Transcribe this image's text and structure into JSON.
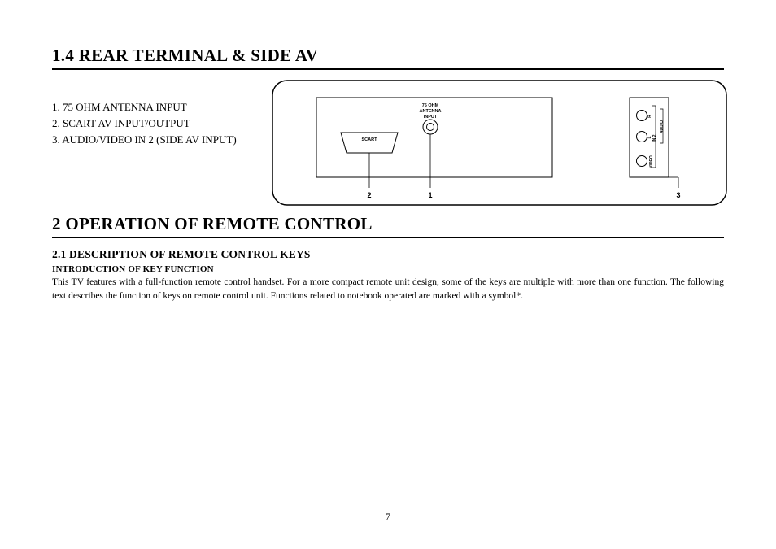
{
  "section1": {
    "heading": "1.4 REAR TERMINAL & SIDE AV",
    "items": [
      "1.  75 OHM ANTENNA INPUT",
      "2.  SCART AV INPUT/OUTPUT",
      "3.  AUDIO/VIDEO IN 2 (SIDE AV INPUT)"
    ]
  },
  "section2": {
    "heading": "2 OPERATION OF REMOTE CONTROL",
    "sub_heading": "2.1 DESCRIPTION OF REMOTE CONTROL KEYS",
    "intro_heading": "INTRODUCTION OF KEY FUNCTION",
    "body": "This TV features with a full-function remote control handset. For a more compact remote unit design, some of the keys are multiple with more than one function. The following text describes the function of keys on remote control unit. Functions related to notebook operated are marked with a symbol*."
  },
  "diagram": {
    "scart_label": "SCART",
    "antenna_label_l1": "75 OHM",
    "antenna_label_l2": "ANTENNA",
    "antenna_label_l3": "INPUT",
    "callout_1": "1",
    "callout_2": "2",
    "callout_3": "3",
    "side_in2": "IN 2",
    "side_audio": "AUDIO",
    "side_video": "VIDEO",
    "side_l": "L",
    "side_r": "R"
  },
  "page_number": "7"
}
